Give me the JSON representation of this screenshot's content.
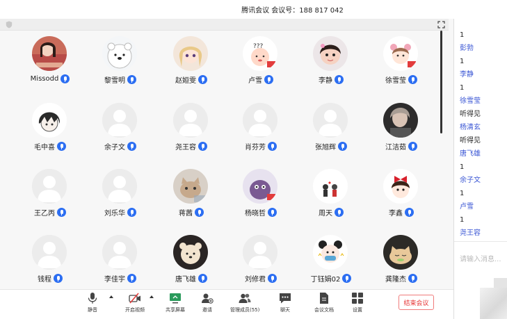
{
  "window": {
    "title": "腾讯会议 会议号：188 817 042"
  },
  "colors": {
    "accent": "#2c6ef2",
    "chat_name": "#3a56d4",
    "end_button": "#e63232"
  },
  "participants": [
    {
      "name": "Missodd",
      "avatar": "photo-pink",
      "mic": "on"
    },
    {
      "name": "黎雪明",
      "avatar": "bear",
      "mic": "on"
    },
    {
      "name": "赵姮雯",
      "avatar": "anime-girl",
      "mic": "on"
    },
    {
      "name": "卢雪",
      "avatar": "cartoon-face",
      "mic": "on"
    },
    {
      "name": "李静",
      "avatar": "child-photo",
      "mic": "on"
    },
    {
      "name": "徐雪莹",
      "avatar": "cartoon-girl",
      "mic": "on"
    },
    {
      "name": "毛中喜",
      "avatar": "anime-boy",
      "mic": "on"
    },
    {
      "name": "余子文",
      "avatar": "default",
      "mic": "on"
    },
    {
      "name": "尧王容",
      "avatar": "default",
      "mic": "on"
    },
    {
      "name": "肖芬芳",
      "avatar": "default",
      "mic": "on"
    },
    {
      "name": "张旭辉",
      "avatar": "default",
      "mic": "on"
    },
    {
      "name": "江洁茹",
      "avatar": "photo-dark",
      "mic": "on"
    },
    {
      "name": "王乙丙",
      "avatar": "default",
      "mic": "on"
    },
    {
      "name": "刘乐华",
      "avatar": "default",
      "mic": "on"
    },
    {
      "name": "蒋茜",
      "avatar": "cat-photo",
      "mic": "on"
    },
    {
      "name": "杨晓哲",
      "avatar": "purple-creature",
      "mic": "on"
    },
    {
      "name": "周天",
      "avatar": "couple-cartoon",
      "mic": "on"
    },
    {
      "name": "李鑫",
      "avatar": "red-bow-girl",
      "mic": "on"
    },
    {
      "name": "钱程",
      "avatar": "default",
      "mic": "on"
    },
    {
      "name": "李佳宇",
      "avatar": "default",
      "mic": "on"
    },
    {
      "name": "唐飞雄",
      "avatar": "bear-face",
      "mic": "on"
    },
    {
      "name": "刘修君",
      "avatar": "default",
      "mic": "on"
    },
    {
      "name": "丁钰娟02",
      "avatar": "panda-girl",
      "mic": "on"
    },
    {
      "name": "龚隆杰",
      "avatar": "sleepy-cat",
      "mic": "on"
    }
  ],
  "toolbar": {
    "mute": "静音",
    "video": "开启视频",
    "share": "共享屏幕",
    "invite": "邀请",
    "members": "管理成员(55)",
    "chat": "聊天",
    "docs": "会议文档",
    "settings": "设置",
    "end": "结束会议"
  },
  "chat": {
    "messages": [
      {
        "type": "text",
        "text": "1"
      },
      {
        "type": "name",
        "text": "彭勃"
      },
      {
        "type": "text",
        "text": "1"
      },
      {
        "type": "name",
        "text": "李静"
      },
      {
        "type": "text",
        "text": "1"
      },
      {
        "type": "name",
        "text": "徐雪莹"
      },
      {
        "type": "text",
        "text": "听得见"
      },
      {
        "type": "name",
        "text": "杨清玄"
      },
      {
        "type": "text",
        "text": "听得见"
      },
      {
        "type": "name",
        "text": "唐飞雄"
      },
      {
        "type": "text",
        "text": "1"
      },
      {
        "type": "name",
        "text": "余子文"
      },
      {
        "type": "text",
        "text": "1"
      },
      {
        "type": "name",
        "text": "卢雪"
      },
      {
        "type": "text",
        "text": "1"
      },
      {
        "type": "name",
        "text": "尧王容"
      }
    ],
    "input_placeholder": "请输入消息..."
  }
}
